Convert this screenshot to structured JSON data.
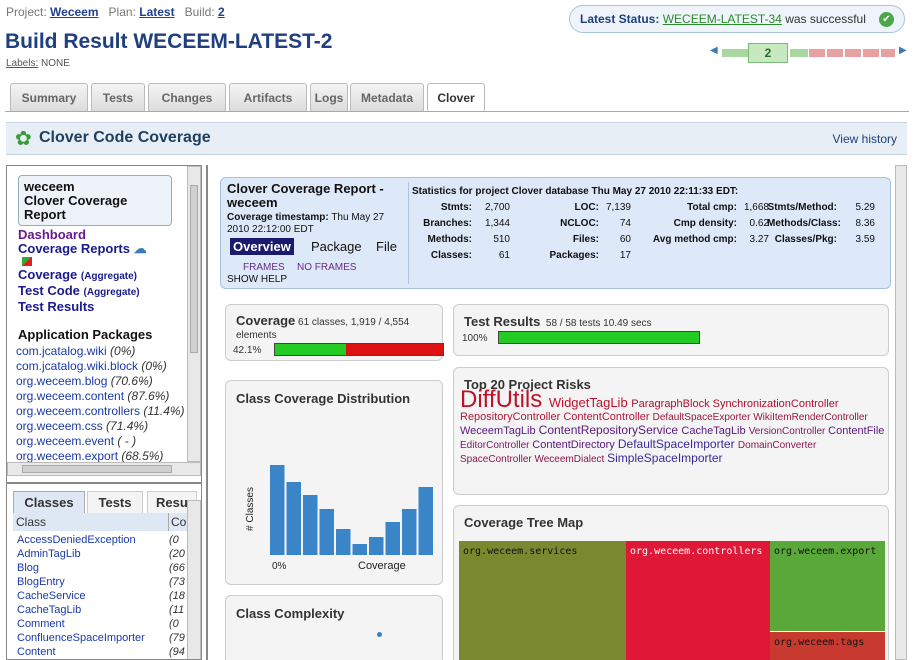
{
  "header": {
    "project_label": "Project:",
    "project": "Weceem",
    "plan_label": "Plan:",
    "plan": "Latest",
    "build_label": "Build:",
    "build": "2",
    "title": "Build Result WECEEM-LATEST-2",
    "labels_label": "Labels:",
    "labels_value": "NONE"
  },
  "status": {
    "prefix": "Latest Status:",
    "link": "WECEEM-LATEST-34",
    "suffix": "was successful",
    "icon": "check-icon"
  },
  "build_nav": {
    "current": "2"
  },
  "tabs": [
    "Summary",
    "Tests",
    "Changes",
    "Artifacts",
    "Logs",
    "Metadata",
    "Clover"
  ],
  "clover": {
    "title": "Clover Code Coverage",
    "view_history": "View history"
  },
  "left": {
    "project_box": "weceem\nClover Coverage\nReport",
    "links": {
      "dashboard": "Dashboard",
      "coverage_reports": "Coverage Reports",
      "coverage": "Coverage",
      "test_code": "Test Code",
      "test_results": "Test Results",
      "aggregate": "(Aggregate)"
    },
    "packages_title": "Application Packages",
    "packages": [
      {
        "name": "com.jcatalog.wiki",
        "pct": "(0%)"
      },
      {
        "name": "com.jcatalog.wiki.block",
        "pct": "(0%)"
      },
      {
        "name": "org.weceem.blog",
        "pct": "(70.6%)"
      },
      {
        "name": "org.weceem.content",
        "pct": "(87.6%)"
      },
      {
        "name": "org.weceem.controllers",
        "pct": "(11.4%)"
      },
      {
        "name": "org.weceem.css",
        "pct": "(71.4%)"
      },
      {
        "name": "org.weceem.event",
        "pct": "( - )"
      },
      {
        "name": "org.weceem.export",
        "pct": "(68.5%)"
      }
    ],
    "sub_tabs": [
      "Classes",
      "Tests",
      "Resu"
    ],
    "col_class": "Class",
    "col_cov": "Co",
    "classes": [
      {
        "name": "AccessDeniedException",
        "cov": "(0"
      },
      {
        "name": "AdminTagLib",
        "cov": "(20"
      },
      {
        "name": "Blog",
        "cov": "(66"
      },
      {
        "name": "BlogEntry",
        "cov": "(73"
      },
      {
        "name": "CacheService",
        "cov": "(18"
      },
      {
        "name": "CacheTagLib",
        "cov": "(11"
      },
      {
        "name": "Comment",
        "cov": "(0"
      },
      {
        "name": "ConfluenceSpaceImporter",
        "cov": "(79"
      },
      {
        "name": "Content",
        "cov": "(94"
      }
    ]
  },
  "report": {
    "title": "Clover Coverage Report - weceem",
    "ts_label": "Coverage timestamp:",
    "ts": "Thu May 27 2010 22:12:00 EDT",
    "nav": [
      "Overview",
      "Package",
      "File"
    ],
    "frames": "FRAMES",
    "noframes": "NO FRAMES",
    "show_help": "SHOW HELP",
    "stats_title": "Statistics for project Clover database Thu May 27 2010 22:11:33 EDT:",
    "stats": [
      [
        [
          "Stmts:",
          "2,700"
        ],
        [
          "LOC:",
          "7,139"
        ],
        [
          "Total cmp:",
          "1,668"
        ],
        [
          "Stmts/Method:",
          "5.29"
        ]
      ],
      [
        [
          "Branches:",
          "1,344"
        ],
        [
          "NCLOC:",
          "74"
        ],
        [
          "Cmp density:",
          "0.62"
        ],
        [
          "Methods/Class:",
          "8.36"
        ]
      ],
      [
        [
          "Methods:",
          "510"
        ],
        [
          "Files:",
          "60"
        ],
        [
          "Avg method cmp:",
          "3.27"
        ],
        [
          "Classes/Pkg:",
          "3.59"
        ]
      ],
      [
        [
          "Classes:",
          "61"
        ],
        [
          "Packages:",
          "17"
        ],
        [
          "",
          ""
        ],
        [
          "",
          ""
        ]
      ]
    ]
  },
  "coverage": {
    "title": "Coverage",
    "detail": "61 classes, 1,919 / 4,554 elements",
    "pct": "42.1%",
    "value": 0.421
  },
  "tests": {
    "title": "Test Results",
    "detail": "58 / 58 tests 10.49 secs",
    "pct": "100%",
    "value": 1.0
  },
  "distribution": {
    "title": "Class Coverage Distribution",
    "ylabel": "# Classes",
    "xlabel": "Coverage",
    "xtick0": "0%"
  },
  "complexity": {
    "title": "Class Complexity"
  },
  "risks": {
    "title": "Top 20 Project Risks",
    "words": [
      {
        "t": "DiffUtils",
        "size": 24,
        "color": "#c0102a"
      },
      {
        "t": "WidgetTagLib",
        "size": 13,
        "color": "#c0102a"
      },
      {
        "t": "ParagraphBlock",
        "size": 11,
        "color": "#b01030"
      },
      {
        "t": "SynchronizationController",
        "size": 11,
        "color": "#b01030"
      },
      {
        "t": "RepositoryController",
        "size": 11,
        "color": "#b01838"
      },
      {
        "t": "ContentController",
        "size": 11,
        "color": "#b01838"
      },
      {
        "t": "DefaultSpaceExporter",
        "size": 10,
        "color": "#9a1840"
      },
      {
        "t": "WikiItemRenderController",
        "size": 10,
        "color": "#9a1840"
      },
      {
        "t": "WeceemTagLib",
        "size": 11,
        "color": "#5a1a80"
      },
      {
        "t": "ContentRepositoryService",
        "size": 12,
        "color": "#5a1a80"
      },
      {
        "t": "CacheTagLib",
        "size": 11,
        "color": "#5a1a80"
      },
      {
        "t": "VersionController",
        "size": 10,
        "color": "#7a1860"
      },
      {
        "t": "ContentFile",
        "size": 11,
        "color": "#5a1a80"
      },
      {
        "t": "EditorController",
        "size": 10,
        "color": "#7a1860"
      },
      {
        "t": "ContentDirectory",
        "size": 11,
        "color": "#5a1a80"
      },
      {
        "t": "DefaultSpaceImporter",
        "size": 12,
        "color": "#3a2a9a"
      },
      {
        "t": "DomainConverter",
        "size": 10,
        "color": "#8a1850"
      },
      {
        "t": "SpaceController",
        "size": 10,
        "color": "#8a1850"
      },
      {
        "t": "WeceemDialect",
        "size": 10,
        "color": "#8a1850"
      },
      {
        "t": "SimpleSpaceImporter",
        "size": 12,
        "color": "#3a2a9a"
      }
    ]
  },
  "treemap": {
    "title": "Coverage Tree Map",
    "cells": [
      {
        "label": "org.weceem.services",
        "color": "#7a8830"
      },
      {
        "label": "org.weceem.controllers",
        "color": "#e01838"
      },
      {
        "label": "org.weceem.export",
        "color": "#5aa83a"
      },
      {
        "label": "org.weceem.tags",
        "color": "#c83a30"
      }
    ]
  },
  "chart_data": {
    "type": "bar",
    "title": "Class Coverage Distribution",
    "xlabel": "Coverage",
    "ylabel": "# Classes",
    "categories": [
      "0%",
      "",
      "",
      "",
      "",
      "",
      "",
      "",
      "",
      ""
    ],
    "values": [
      9,
      7.3,
      6,
      4.6,
      2.6,
      1.1,
      1.8,
      3.3,
      4.6,
      6.8
    ]
  },
  "colors": {
    "accent": "#1f3f7f",
    "covered": "#22cc22",
    "uncovered": "#dd1111",
    "bar": "#3a85c8"
  }
}
